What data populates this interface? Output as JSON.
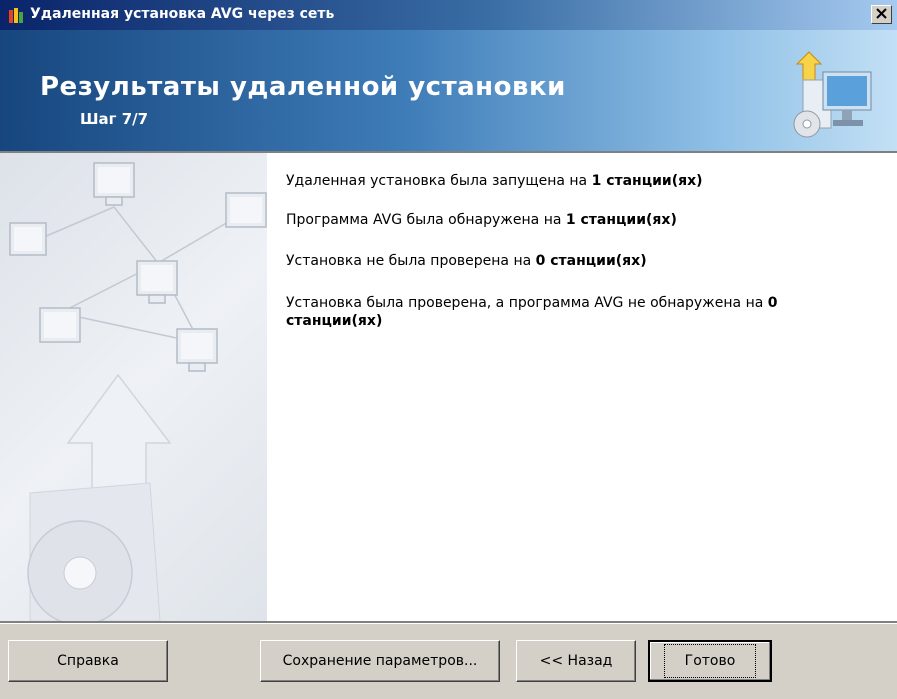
{
  "window": {
    "title": "Удаленная установка AVG через сеть",
    "close_label": "×"
  },
  "header": {
    "heading": "Результаты удаленной установки",
    "step": "Шаг 7/7"
  },
  "results": [
    {
      "text": "Удаленная установка была запущена на ",
      "value": "1 станции(ях)"
    },
    {
      "text": "Программа AVG была обнаружена на ",
      "value": "1 станции(ях)"
    },
    {
      "text": "Установка не была проверена на ",
      "value": "0 станции(ях)"
    },
    {
      "text": "Установка была проверена, а программа AVG не обнаружена на ",
      "value": "0 станции(ях)"
    }
  ],
  "buttons": {
    "help": "Справка",
    "save": "Сохранение параметров...",
    "back": "<< Назад",
    "finish": "Готово"
  },
  "icons": {
    "app": "avg-app-icon",
    "header": "network-computer-icon",
    "side": "network-diagram-illustration"
  },
  "colors": {
    "title_bar": "#0a246a",
    "header_dark": "#17467e",
    "header_light": "#c3e0f5",
    "dialog_face": "#d4d0c8"
  }
}
